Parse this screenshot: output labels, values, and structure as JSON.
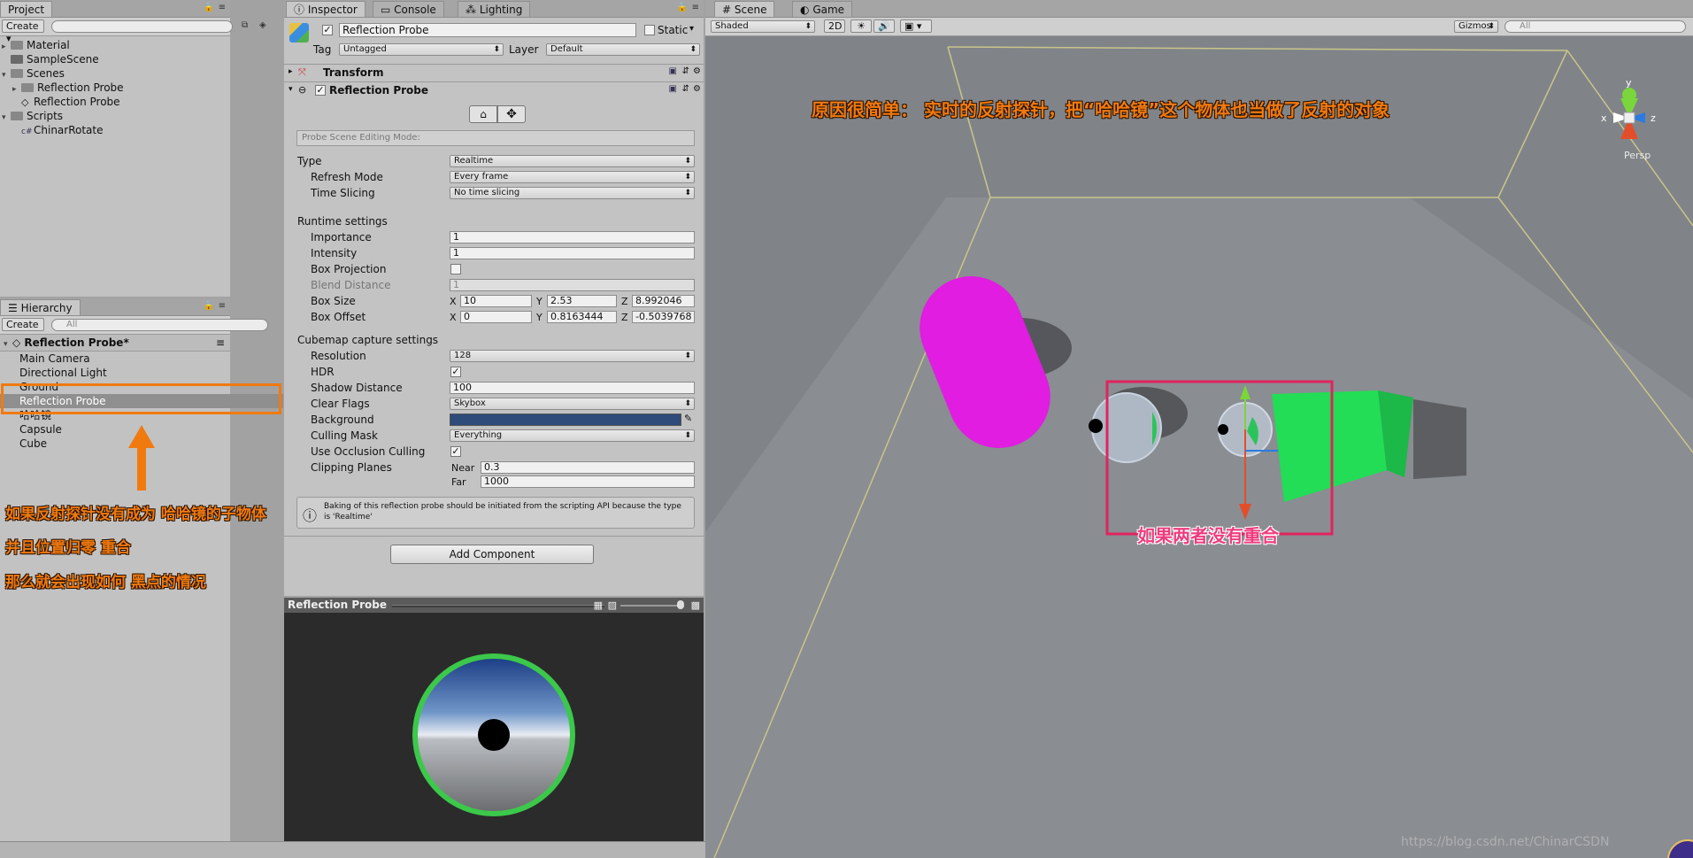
{
  "project": {
    "tab": "Project",
    "create": "Create",
    "items": [
      {
        "label": "Material",
        "type": "folder",
        "depth": 0
      },
      {
        "label": "SampleScene",
        "type": "scene",
        "depth": 0
      },
      {
        "label": "Scenes",
        "type": "folder",
        "depth": 0
      },
      {
        "label": "Reflection Probe",
        "type": "folder",
        "depth": 1
      },
      {
        "label": "Reflection Probe",
        "type": "scene",
        "depth": 1
      },
      {
        "label": "Scripts",
        "type": "folder",
        "depth": 0
      },
      {
        "label": "ChinarRotate",
        "type": "script",
        "depth": 1
      }
    ]
  },
  "hierarchy": {
    "tab": "Hierarchy",
    "create": "Create",
    "search_placeholder": "All",
    "scene": "Reflection Probe*",
    "items": [
      "Main Camera",
      "Directional Light",
      "Ground",
      "Reflection Probe",
      "哈哈镜",
      "Capsule",
      "Cube"
    ]
  },
  "annotations_left": [
    "如果反射探针没有成为 哈哈镜的子物体",
    "并且位置归零 重合",
    "那么就会出现如何 黑点的情况"
  ],
  "inspector": {
    "tabs": [
      "Inspector",
      "Console",
      "Lighting"
    ],
    "object_name": "Reflection Probe",
    "static_label": "Static",
    "tag_label": "Tag",
    "tag_value": "Untagged",
    "layer_label": "Layer",
    "layer_value": "Default",
    "transform": "Transform",
    "component": "Reflection Probe",
    "edit_mode": "Probe Scene Editing Mode:",
    "type_label": "Type",
    "type_value": "Realtime",
    "refresh_label": "Refresh Mode",
    "refresh_value": "Every frame",
    "slicing_label": "Time Slicing",
    "slicing_value": "No time slicing",
    "runtime_header": "Runtime settings",
    "importance_label": "Importance",
    "importance_value": "1",
    "intensity_label": "Intensity",
    "intensity_value": "1",
    "boxproj_label": "Box Projection",
    "blend_label": "Blend Distance",
    "blend_value": "1",
    "boxsize_label": "Box Size",
    "boxsize": {
      "x": "10",
      "y": "2.53",
      "z": "8.992046"
    },
    "boxoffset_label": "Box Offset",
    "boxoffset": {
      "x": "0",
      "y": "0.8163444",
      "z": "-0.5039768"
    },
    "axis": {
      "x": "X",
      "y": "Y",
      "z": "Z"
    },
    "cubemap_header": "Cubemap capture settings",
    "resolution_label": "Resolution",
    "resolution_value": "128",
    "hdr_label": "HDR",
    "shadow_label": "Shadow Distance",
    "shadow_value": "100",
    "clear_label": "Clear Flags",
    "clear_value": "Skybox",
    "background_label": "Background",
    "background_color": "#2e4b7a",
    "culling_label": "Culling Mask",
    "culling_value": "Everything",
    "occlusion_label": "Use Occlusion Culling",
    "clipping_label": "Clipping Planes",
    "near_label": "Near",
    "near_value": "0.3",
    "far_label": "Far",
    "far_value": "1000",
    "info_text": "Baking of this reflection probe should be initiated from the scripting API because the type is 'Realtime'",
    "add_component": "Add Component",
    "preview_title": "Reflection Probe"
  },
  "scene": {
    "tabs": [
      "Scene",
      "Game"
    ],
    "shaded": "Shaded",
    "mode_2d": "2D",
    "gizmos": "Gizmos",
    "search_placeholder": "All",
    "persp": "Persp",
    "gizmo_axes": {
      "x": "x",
      "y": "y",
      "z": "z"
    },
    "annotation_top": "原因很简单： 实时的反射探针，把“哈哈镜”这个物体也当做了反射的对象",
    "annotation_mid": "如果两者没有重合",
    "watermark": "https://blog.csdn.net/ChinarCSDN"
  },
  "colors": {
    "capsule": "#e01de0",
    "cube": "#22dd55",
    "highlight_orange": "#f07a10",
    "highlight_pink": "#e0245e"
  }
}
